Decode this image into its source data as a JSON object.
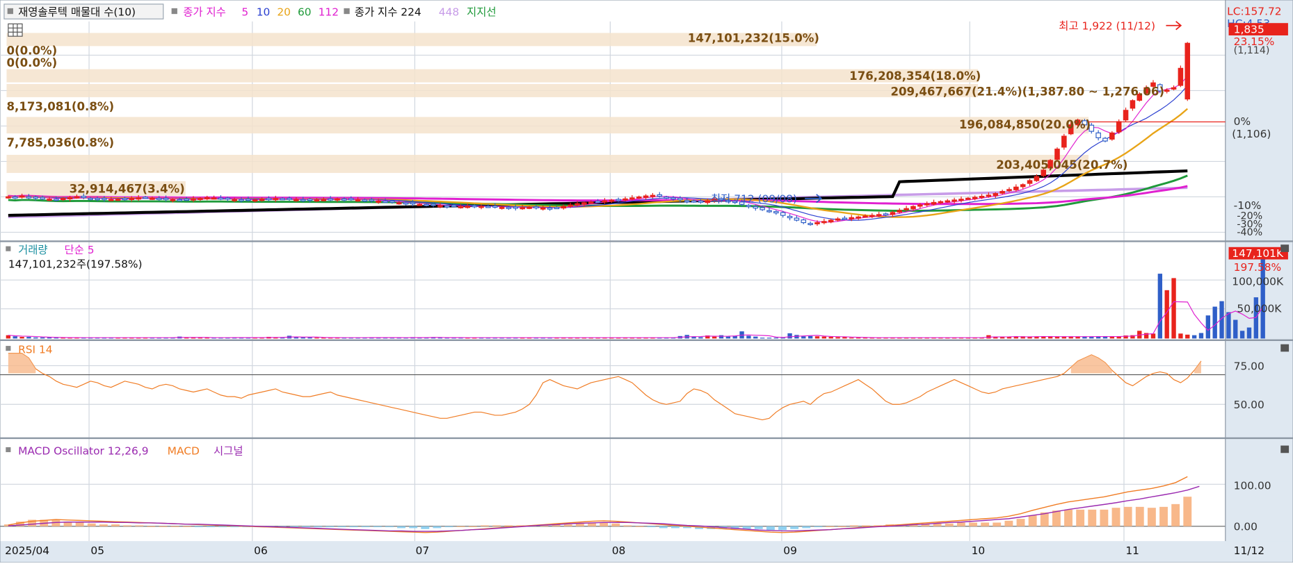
{
  "header": {
    "title_box": "재영솔루텍 매물대 수(10)",
    "ma_label": "종가 지수",
    "ma_periods": [
      "5",
      "10",
      "20",
      "60",
      "112"
    ],
    "ma2_label": "종가 지수 224",
    "ma2_extra": "448",
    "support_label": "지지선"
  },
  "colors": {
    "up": "#e8231c",
    "down": "#2f5fc8",
    "ma5": "#e020d0",
    "ma10": "#2a3fd0",
    "ma20": "#e8a417",
    "ma60": "#1f9a3a",
    "ma112": "#e020d0",
    "ma224": "#000000",
    "ma448": "#c79ce8",
    "support": "#2aa02a",
    "rsi": "#f07c24",
    "macd": "#f07c24",
    "signal": "#9a2ab0",
    "osc": "#f8b88a",
    "grid": "#d0d6de",
    "panel_bg": "#dfe8f1"
  },
  "price_panel": {
    "axis_labels": [
      "LC:157.72",
      "HC:4.53"
    ],
    "last_price": "1,835",
    "last_change": "23.15%",
    "last_sub": "(1,114)",
    "ref_pct": "0%",
    "ref_price": "(1,106)",
    "scale_pct": [
      "-10%",
      "-20%",
      "-30%",
      "-40%"
    ],
    "high_label": "최고 1,922 (11/12)",
    "low_label": "최저 712 (09/08)",
    "volume_profile": [
      {
        "label": "0(0.0%)"
      },
      {
        "label": "0(0.0%)"
      },
      {
        "label": "147,101,232(15.0%)"
      },
      {
        "label": "176,208,354(18.0%)"
      },
      {
        "label": "209,467,667(21.4%)(1,387.80 ~ 1,276.06)"
      },
      {
        "label": "8,173,081(0.8%)"
      },
      {
        "label": "196,084,850(20.0%)"
      },
      {
        "label": "7,785,036(0.8%)"
      },
      {
        "label": "203,405,045(20.7%)"
      },
      {
        "label": "32,914,467(3.4%)"
      }
    ]
  },
  "volume_panel": {
    "title": "거래량",
    "ma_label": "단순 5",
    "info": "147,101,232주(197.58%)",
    "last_value": "147,101K",
    "last_pct": "197.58%",
    "ticks": [
      "100,000K",
      "50,000K"
    ]
  },
  "rsi_panel": {
    "title": "RSI 14",
    "ticks": [
      "75.00",
      "50.00"
    ]
  },
  "macd_panel": {
    "title": "MACD Oscillator 12,26,9",
    "macd_label": "MACD",
    "signal_label": "시그널",
    "ticks": [
      "100.00",
      "0.00"
    ]
  },
  "x_axis": {
    "labels": [
      "2025/04",
      "05",
      "06",
      "07",
      "08",
      "09",
      "10",
      "11"
    ],
    "last_date": "11/12"
  },
  "chart_data": {
    "type": "candlestick",
    "dates_range": [
      "2025/04",
      "11/12"
    ],
    "price_high": {
      "value": 1922,
      "date": "11/12"
    },
    "price_low": {
      "value": 712,
      "date": "09/08"
    },
    "last_close": 1835,
    "close": [
      885,
      880,
      890,
      885,
      878,
      872,
      870,
      868,
      875,
      880,
      885,
      880,
      875,
      872,
      870,
      868,
      870,
      872,
      875,
      878,
      880,
      876,
      872,
      870,
      868,
      866,
      868,
      872,
      875,
      880,
      878,
      874,
      870,
      868,
      866,
      864,
      866,
      870,
      872,
      874,
      872,
      870,
      868,
      866,
      865,
      866,
      868,
      870,
      872,
      870,
      868,
      866,
      864,
      862,
      858,
      855,
      852,
      848,
      845,
      842,
      838,
      835,
      832,
      830,
      828,
      826,
      824,
      826,
      828,
      826,
      824,
      822,
      820,
      818,
      816,
      818,
      820,
      818,
      816,
      814,
      818,
      826,
      834,
      842,
      848,
      852,
      856,
      860,
      864,
      868,
      872,
      878,
      884,
      890,
      894,
      888,
      880,
      872,
      866,
      860,
      855,
      852,
      860,
      870,
      866,
      858,
      850,
      838,
      826,
      815,
      805,
      795,
      785,
      770,
      755,
      740,
      725,
      718,
      725,
      732,
      740,
      748,
      752,
      756,
      760,
      766,
      770,
      775,
      778,
      788,
      800,
      812,
      825,
      835,
      842,
      850,
      855,
      860,
      865,
      870,
      876,
      882,
      888,
      895,
      905,
      918,
      930,
      945,
      960,
      985,
      1010,
      1050,
      1110,
      1180,
      1260,
      1330,
      1360,
      1330,
      1290,
      1250,
      1230,
      1280,
      1350,
      1420,
      1480,
      1520,
      1560,
      1590,
      1540,
      1545,
      1560,
      1680,
      1835
    ],
    "volume_k": [
      6000,
      4000,
      3000,
      3000,
      2000,
      2000,
      2000,
      1500,
      1500,
      1500,
      1500,
      1500,
      1500,
      1500,
      1500,
      1500,
      1500,
      1500,
      1500,
      1500,
      1500,
      1500,
      1500,
      1500,
      1500,
      3500,
      1500,
      1500,
      1500,
      1500,
      1500,
      1500,
      1500,
      2000,
      1500,
      1500,
      1500,
      1500,
      3000,
      2000,
      1500,
      5000,
      2500,
      2000,
      2000,
      1500,
      1500,
      1500,
      1500,
      1500,
      1500,
      1500,
      1500,
      2000,
      1500,
      1500,
      1500,
      1500,
      1500,
      2500,
      1500,
      1500,
      2500,
      1500,
      1500,
      1500,
      1500,
      1500,
      1500,
      1500,
      1500,
      1500,
      1500,
      1500,
      1500,
      1500,
      1500,
      1500,
      1500,
      1500,
      1500,
      1500,
      1500,
      1500,
      1500,
      1500,
      1500,
      1500,
      1500,
      1500,
      1500,
      1500,
      1500,
      1500,
      1500,
      1500,
      1500,
      1500,
      4500,
      6500,
      3000,
      2500,
      5500,
      3500,
      6000,
      3500,
      5000,
      13000,
      5000,
      3500,
      1500,
      1500,
      1500,
      1500,
      9500,
      6500,
      4000,
      4500,
      4000,
      3500,
      3000,
      2500,
      2500,
      1500,
      1500,
      1500,
      1500,
      1500,
      1500,
      1500,
      1500,
      1500,
      1500,
      1500,
      1500,
      1500,
      1500,
      1500,
      1500,
      1500,
      1500,
      1500,
      1500,
      6000,
      3500,
      2500,
      2500,
      3500,
      4000,
      3500,
      3500,
      3500,
      3500,
      3500,
      3500,
      3500,
      3500,
      3500,
      3500,
      4000,
      3500,
      3500,
      3500,
      5500,
      6000,
      14000,
      10000,
      9000,
      118000,
      88000,
      110000,
      9000,
      7000,
      6000,
      10000,
      42000,
      58000,
      68000,
      48000,
      34000,
      14000,
      20000,
      75000,
      147101
    ],
    "rsi": [
      83,
      83,
      83,
      80,
      73,
      70,
      68,
      65,
      63,
      62,
      61,
      63,
      65,
      64,
      62,
      61,
      63,
      65,
      64,
      63,
      61,
      60,
      62,
      63,
      62,
      60,
      59,
      58,
      59,
      60,
      58,
      56,
      55,
      55,
      54,
      56,
      57,
      58,
      59,
      60,
      58,
      57,
      56,
      55,
      55,
      56,
      57,
      58,
      56,
      55,
      54,
      53,
      52,
      51,
      50,
      49,
      48,
      47,
      46,
      45,
      44,
      43,
      42,
      41,
      41,
      42,
      43,
      44,
      45,
      45,
      44,
      43,
      43,
      44,
      45,
      47,
      50,
      56,
      64,
      66,
      64,
      62,
      61,
      60,
      62,
      64,
      65,
      66,
      67,
      68,
      66,
      64,
      60,
      56,
      53,
      51,
      50,
      51,
      52,
      57,
      60,
      59,
      57,
      53,
      50,
      47,
      44,
      43,
      42,
      41,
      40,
      41,
      45,
      48,
      50,
      51,
      52,
      50,
      54,
      57,
      58,
      60,
      62,
      64,
      66,
      63,
      60,
      56,
      52,
      50,
      50,
      51,
      53,
      55,
      58,
      60,
      62,
      64,
      66,
      64,
      62,
      60,
      58,
      57,
      58,
      60,
      61,
      62,
      63,
      64,
      65,
      66,
      67,
      68,
      70,
      74,
      78,
      80,
      82,
      80,
      77,
      72,
      68,
      64,
      62,
      65,
      68,
      70,
      71,
      70,
      66,
      64,
      67,
      72,
      78
    ],
    "macd": [
      3,
      8,
      12,
      14,
      16,
      15,
      14,
      13,
      12,
      11,
      10,
      9,
      8,
      7,
      6,
      5,
      4,
      3,
      2,
      1,
      0,
      -1,
      -2,
      -3,
      -4,
      -5,
      -6,
      -7,
      -8,
      -9,
      -10,
      -11,
      -12,
      -13,
      -14,
      -15,
      -14,
      -12,
      -10,
      -8,
      -6,
      -4,
      -2,
      0,
      2,
      4,
      6,
      8,
      10,
      12,
      13,
      12,
      10,
      8,
      6,
      4,
      2,
      0,
      -2,
      -4,
      -6,
      -8,
      -10,
      -12,
      -14,
      -15,
      -14,
      -12,
      -10,
      -8,
      -6,
      -4,
      -2,
      0,
      2,
      4,
      6,
      8,
      10,
      12,
      14,
      16,
      18,
      20,
      24,
      30,
      38,
      45,
      52,
      58,
      62,
      66,
      70,
      76,
      82,
      86,
      90,
      96,
      104,
      118
    ],
    "signal": [
      1,
      3,
      5,
      7,
      9,
      10,
      10,
      10,
      10,
      9,
      9,
      8,
      8,
      7,
      6,
      5,
      5,
      4,
      3,
      2,
      1,
      0,
      -1,
      -2,
      -3,
      -4,
      -5,
      -6,
      -7,
      -8,
      -9,
      -10,
      -11,
      -11,
      -12,
      -12,
      -12,
      -11,
      -10,
      -8,
      -7,
      -5,
      -3,
      -1,
      1,
      3,
      4,
      6,
      7,
      8,
      9,
      9,
      9,
      8,
      7,
      6,
      4,
      2,
      1,
      -1,
      -3,
      -5,
      -7,
      -9,
      -10,
      -11,
      -11,
      -10,
      -9,
      -8,
      -6,
      -5,
      -3,
      -1,
      0,
      2,
      4,
      5,
      7,
      9,
      10,
      12,
      14,
      16,
      18,
      22,
      26,
      30,
      35,
      40,
      44,
      48,
      52,
      56,
      61,
      65,
      70,
      75,
      80,
      86,
      95
    ]
  }
}
